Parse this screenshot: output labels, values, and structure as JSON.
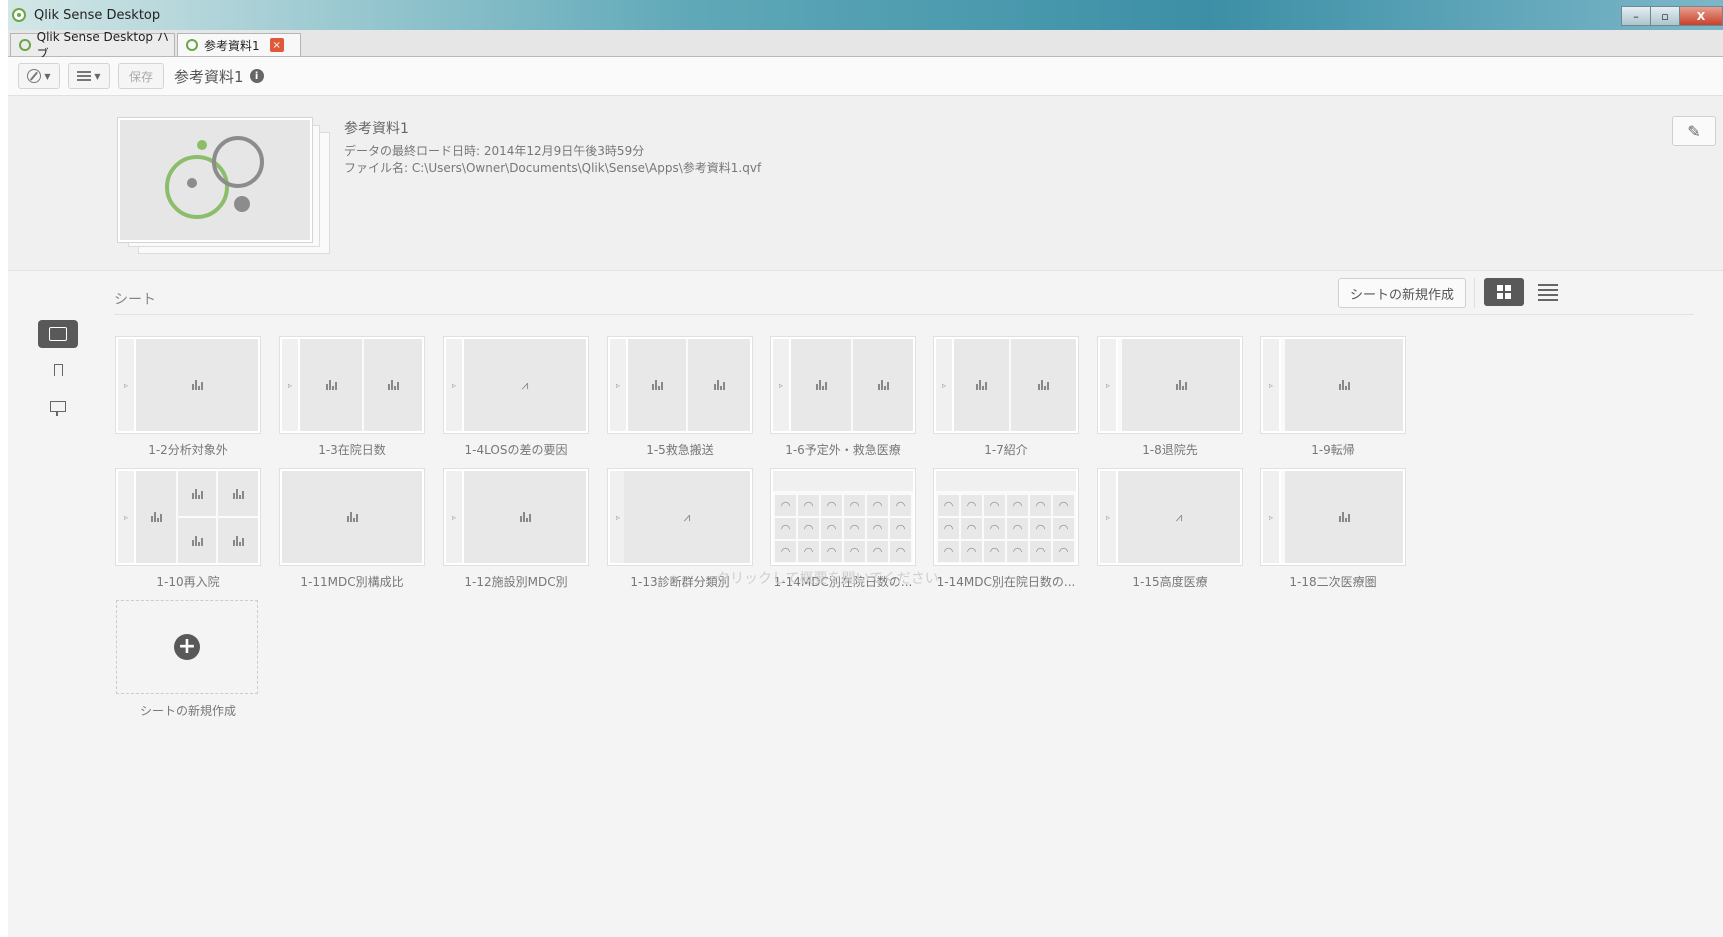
{
  "window": {
    "title": "Qlik Sense Desktop",
    "controls": [
      "–",
      "▫",
      "X"
    ]
  },
  "tabs": [
    {
      "label": "Qlik Sense Desktop ハブ"
    },
    {
      "label": "参考資料1",
      "close": "×"
    }
  ],
  "toolbar": {
    "save_label": "保存",
    "app_title": "参考資料1",
    "info_label": "i"
  },
  "app": {
    "name": "参考資料1",
    "last_load": "データの最終ロード日時: 2014年12月9日午後3時59分",
    "file_name": "ファイル名: C:\\Users\\Owner\\Documents\\Qlik\\Sense\\Apps\\参考資料1.qvf"
  },
  "sheets_section": {
    "label": "シート",
    "new_sheet_label": "シートの新規作成",
    "overlay_text": "クリックして概要を開いてください"
  },
  "sheets": [
    {
      "label": "1-2分析対象外"
    },
    {
      "label": "1-3在院日数"
    },
    {
      "label": "1-4LOSの差の要因"
    },
    {
      "label": "1-5救急搬送"
    },
    {
      "label": "1-6予定外・救急医療"
    },
    {
      "label": "1-7紹介"
    },
    {
      "label": "1-8退院先"
    },
    {
      "label": "1-9転帰"
    },
    {
      "label": "1-10再入院"
    },
    {
      "label": "1-11MDC別構成比"
    },
    {
      "label": "1-12施設別MDC別"
    },
    {
      "label": "1-13診断群分類別"
    },
    {
      "label": "1-14MDC別在院日数の..."
    },
    {
      "label": "1-14MDC別在院日数の..."
    },
    {
      "label": "1-15高度医療"
    },
    {
      "label": "1-18二次医療圏"
    }
  ],
  "new_sheet_card": {
    "label": "シートの新規作成"
  },
  "colors": {
    "accent": "#6da54a",
    "active_button": "#595959",
    "tab_close": "#e05a3a"
  }
}
